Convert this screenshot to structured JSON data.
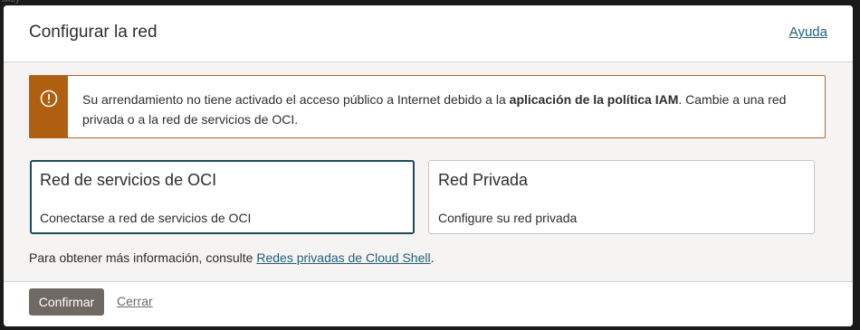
{
  "backdrop": {
    "partial_text": "ilkey"
  },
  "dialog": {
    "title": "Configurar la red",
    "help_label": "Ayuda"
  },
  "warning": {
    "icon": "exclamation-circle-icon",
    "color": "#b05e0f",
    "text_before": "Su arrendamiento no tiene activado el acceso público a Internet debido a la ",
    "text_bold": "aplicación de la política IAM",
    "text_after": ". Cambie a una red privada o a la red de servicios de OCI."
  },
  "network_options": [
    {
      "title": "Red de servicios de OCI",
      "description": "Conectarse a red de servicios de OCI",
      "selected": true
    },
    {
      "title": "Red Privada",
      "description": "Configure su red privada",
      "selected": false
    }
  ],
  "info": {
    "prefix": "Para obtener más información, consulte ",
    "link_label": "Redes privadas de Cloud Shell",
    "suffix": "."
  },
  "footer": {
    "confirm_label": "Confirmar",
    "close_label": "Cerrar"
  },
  "colors": {
    "accent_link": "#21617a",
    "selected_border": "#1e4a5a",
    "primary_button": "#6f6964"
  }
}
